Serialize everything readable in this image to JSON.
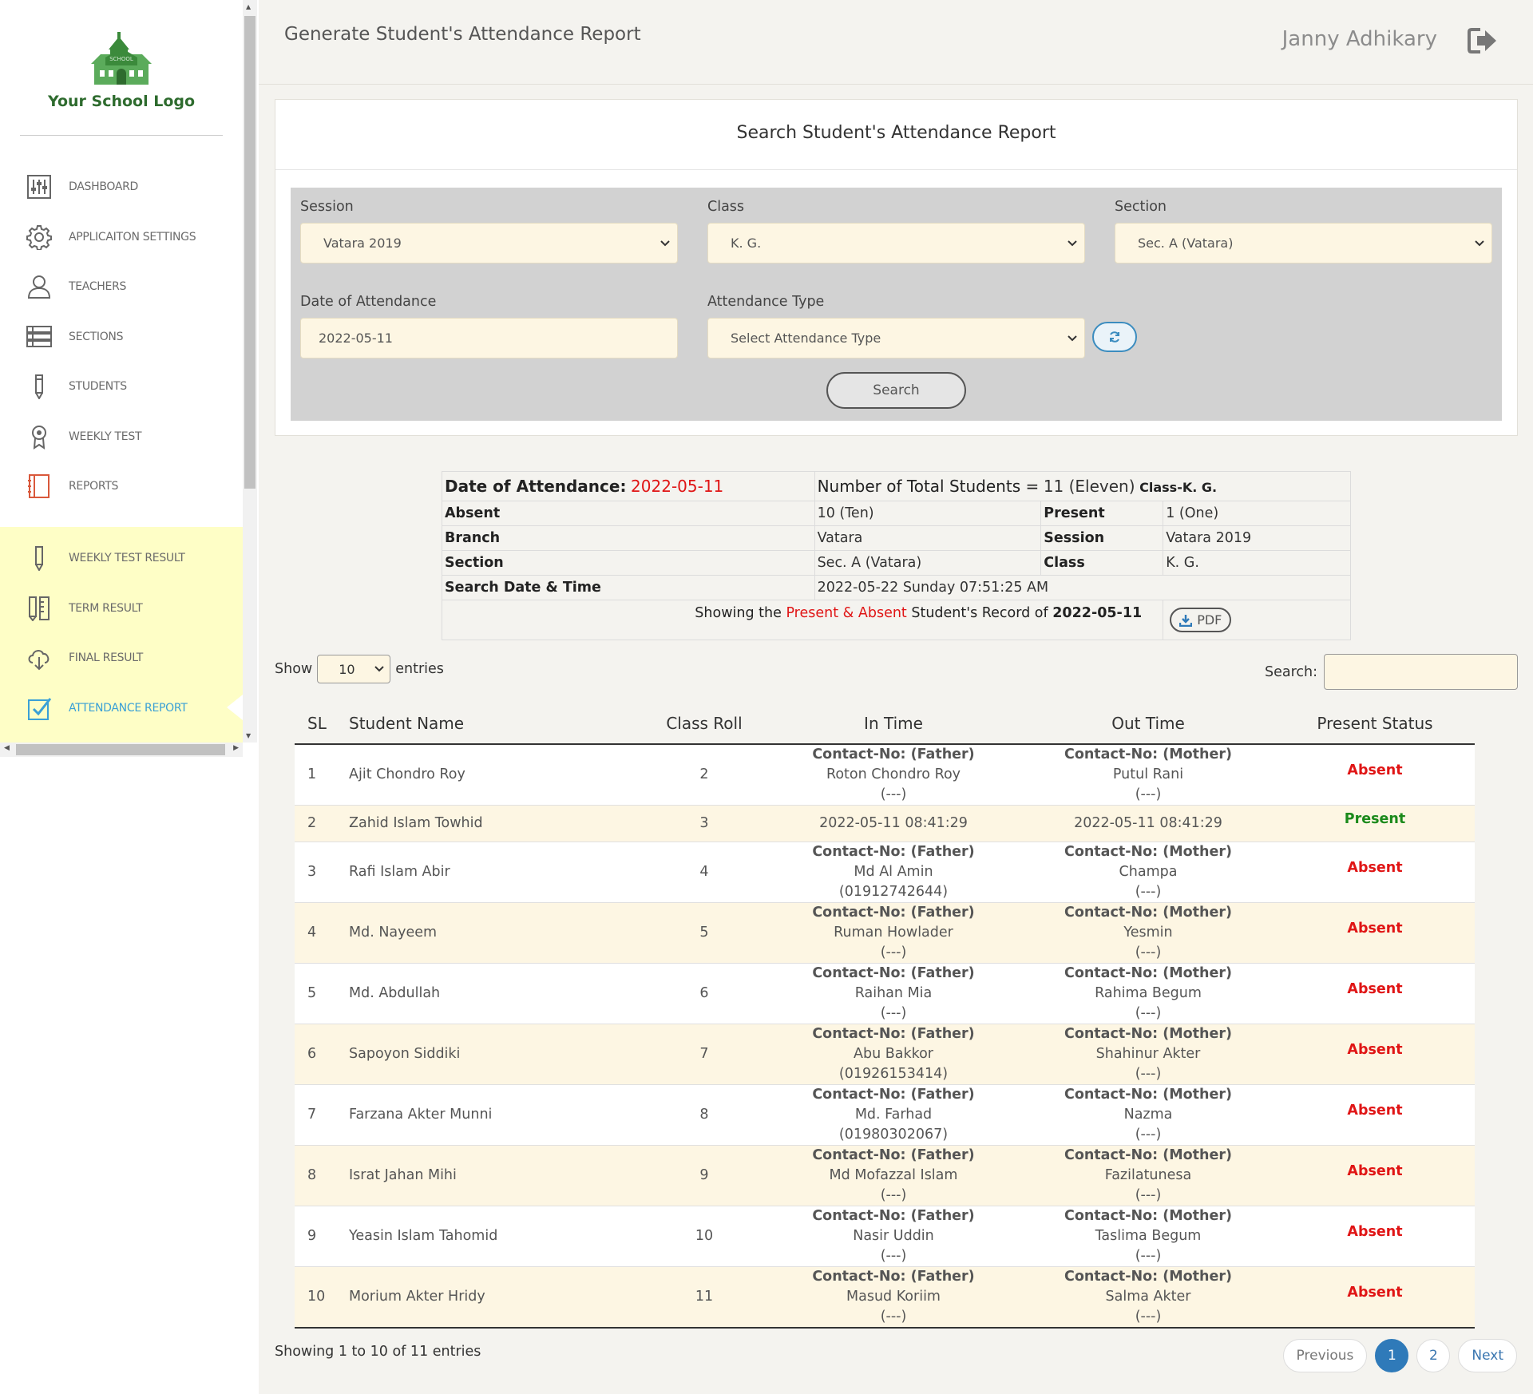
{
  "logo": {
    "text": "Your School Logo",
    "badge": "SCHOOL"
  },
  "sidebar": {
    "main_items": [
      {
        "label": "DASHBOARD",
        "icon": "sliders-icon"
      },
      {
        "label": "APPLICAITON SETTINGS",
        "icon": "gear-icon"
      },
      {
        "label": "TEACHERS",
        "icon": "user-icon"
      },
      {
        "label": "SECTIONS",
        "icon": "list-icon"
      },
      {
        "label": "STUDENTS",
        "icon": "pencil-icon"
      },
      {
        "label": "WEEKLY TEST",
        "icon": "award-icon"
      },
      {
        "label": "REPORTS",
        "icon": "notebook-icon"
      }
    ],
    "result_items": [
      {
        "label": "WEEKLY TEST RESULT",
        "icon": "pencil-icon"
      },
      {
        "label": "TERM RESULT",
        "icon": "pencil-ruler-icon"
      },
      {
        "label": "FINAL RESULT",
        "icon": "cloud-download-icon"
      },
      {
        "label": "ATTENDANCE REPORT",
        "icon": "checkbox-icon",
        "active": true
      }
    ]
  },
  "header": {
    "title": "Generate Student's Attendance Report",
    "user": "Janny Adhikary"
  },
  "search_panel": {
    "title": "Search Student's Attendance Report",
    "session": {
      "label": "Session",
      "value": "Vatara 2019"
    },
    "class": {
      "label": "Class",
      "value": "K. G."
    },
    "section": {
      "label": "Section",
      "value": "Sec. A (Vatara)"
    },
    "date": {
      "label": "Date of Attendance",
      "value": "2022-05-11"
    },
    "type": {
      "label": "Attendance Type",
      "value": "Select Attendance Type"
    },
    "search_button": "Search"
  },
  "summary": {
    "date_label": "Date of Attendance:",
    "date_value": "2022-05-11",
    "total_label": "Number of Total Students =",
    "total_value": "11 (Eleven)",
    "class_tag": "Class-K. G.",
    "absent_label": "Absent",
    "absent_value": "10 (Ten)",
    "present_label": "Present",
    "present_value": "1 (One)",
    "branch_label": "Branch",
    "branch_value": "Vatara",
    "session_label": "Session",
    "session_value": "Vatara 2019",
    "section_label": "Section",
    "section_value": "Sec. A (Vatara)",
    "class_label": "Class",
    "class_value": "K. G.",
    "search_dt_label": "Search Date & Time",
    "search_dt_value": "2022-05-22 Sunday 07:51:25 AM",
    "showing_prefix": "Showing the",
    "showing_mid": "Present & Absent",
    "showing_suffix": "Student's Record of",
    "showing_date": "2022-05-11",
    "pdf_label": "PDF"
  },
  "table_controls": {
    "show_label": "Show",
    "entries_value": "10",
    "entries_label": "entries",
    "search_label": "Search:"
  },
  "table": {
    "headers": [
      "SL",
      "Student Name",
      "Class Roll",
      "In Time",
      "Out Time",
      "Present Status"
    ],
    "rows": [
      {
        "sl": "1",
        "name": "Ajit Chondro Roy",
        "roll": "2",
        "in_label": "Contact-No: (Father)",
        "in_name": "Roton Chondro Roy",
        "in_phone": "(---)",
        "out_label": "Contact-No: (Mother)",
        "out_name": "Putul Rani",
        "out_phone": "(---)",
        "status": "Absent"
      },
      {
        "sl": "2",
        "name": "Zahid Islam Towhid",
        "roll": "3",
        "in_time": "2022-05-11 08:41:29",
        "out_time": "2022-05-11 08:41:29",
        "status": "Present"
      },
      {
        "sl": "3",
        "name": "Rafi Islam Abir",
        "roll": "4",
        "in_label": "Contact-No: (Father)",
        "in_name": "Md Al Amin",
        "in_phone": "(01912742644)",
        "out_label": "Contact-No: (Mother)",
        "out_name": "Champa",
        "out_phone": "(---)",
        "status": "Absent"
      },
      {
        "sl": "4",
        "name": "Md. Nayeem",
        "roll": "5",
        "in_label": "Contact-No: (Father)",
        "in_name": "Ruman Howlader",
        "in_phone": "(---)",
        "out_label": "Contact-No: (Mother)",
        "out_name": "Yesmin",
        "out_phone": "(---)",
        "status": "Absent"
      },
      {
        "sl": "5",
        "name": "Md. Abdullah",
        "roll": "6",
        "in_label": "Contact-No: (Father)",
        "in_name": "Raihan Mia",
        "in_phone": "(---)",
        "out_label": "Contact-No: (Mother)",
        "out_name": "Rahima Begum",
        "out_phone": "(---)",
        "status": "Absent"
      },
      {
        "sl": "6",
        "name": "Sapoyon Siddiki",
        "roll": "7",
        "in_label": "Contact-No: (Father)",
        "in_name": "Abu Bakkor",
        "in_phone": "(01926153414)",
        "out_label": "Contact-No: (Mother)",
        "out_name": "Shahinur Akter",
        "out_phone": "(---)",
        "status": "Absent"
      },
      {
        "sl": "7",
        "name": "Farzana Akter Munni",
        "roll": "8",
        "in_label": "Contact-No: (Father)",
        "in_name": "Md. Farhad",
        "in_phone": "(01980302067)",
        "out_label": "Contact-No: (Mother)",
        "out_name": "Nazma",
        "out_phone": "(---)",
        "status": "Absent"
      },
      {
        "sl": "8",
        "name": "Israt Jahan Mihi",
        "roll": "9",
        "in_label": "Contact-No: (Father)",
        "in_name": "Md Mofazzal Islam",
        "in_phone": "(---)",
        "out_label": "Contact-No: (Mother)",
        "out_name": "Fazilatunesa",
        "out_phone": "(---)",
        "status": "Absent"
      },
      {
        "sl": "9",
        "name": "Yeasin Islam Tahomid",
        "roll": "10",
        "in_label": "Contact-No: (Father)",
        "in_name": "Nasir Uddin",
        "in_phone": "(---)",
        "out_label": "Contact-No: (Mother)",
        "out_name": "Taslima Begum",
        "out_phone": "(---)",
        "status": "Absent"
      },
      {
        "sl": "10",
        "name": "Morium Akter Hridy",
        "roll": "11",
        "in_label": "Contact-No: (Father)",
        "in_name": "Masud Koriim",
        "in_phone": "(---)",
        "out_label": "Contact-No: (Mother)",
        "out_name": "Salma Akter",
        "out_phone": "(---)",
        "status": "Absent"
      }
    ]
  },
  "footer": {
    "info": "Showing 1 to 10 of 11 entries",
    "prev": "Previous",
    "pages": [
      "1",
      "2"
    ],
    "next": "Next"
  },
  "colors": {
    "accent": "#2f7ab9",
    "absent": "#e01515",
    "present": "#1b8a1b",
    "sidebar_highlight": "#fefec6",
    "input_bg": "#fdf6e3"
  }
}
